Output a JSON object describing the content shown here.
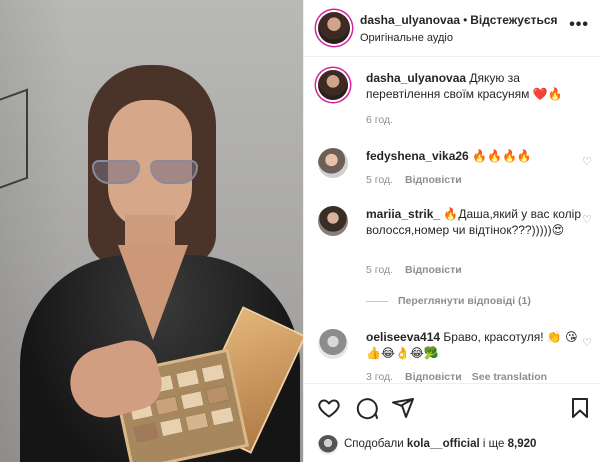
{
  "post": {
    "username": "dasha_ulyanovaa",
    "separator": "•",
    "follow_label": "Відстежується",
    "audio": "Оригінальне аудіо",
    "more_label": "•••"
  },
  "caption": {
    "username": "dasha_ulyanovaa",
    "text": "Дякую за перевтілення своїм красуням ❤️🔥",
    "time": "6 год."
  },
  "comments": [
    {
      "username": "fedyshena_vika26",
      "text": "🔥🔥🔥🔥",
      "time": "5 год.",
      "reply_label": "Відповісти"
    },
    {
      "username": "mariia_strik_",
      "text": "🔥Даша,який у вас колір волосся,номер чи відтінок???)))))😍",
      "time": "5 год.",
      "reply_label": "Відповісти"
    },
    {
      "username": "oeliseeva414",
      "text": "Браво, красотуля! 👏 😘👍😂👌😂🥦",
      "time": "3 год.",
      "reply_label": "Відповісти",
      "translate_label": "See translation"
    }
  ],
  "view_replies": "Переглянути відповіді (1)",
  "likes": {
    "prefix": "Сподобали",
    "user": "kola__official",
    "connector": "і ще",
    "count": "8,920"
  },
  "icons": {
    "like": "heart-outline-icon",
    "comment": "comment-bubble-icon",
    "share": "paper-plane-icon",
    "save": "bookmark-icon",
    "comment_like": "small-heart-icon"
  }
}
